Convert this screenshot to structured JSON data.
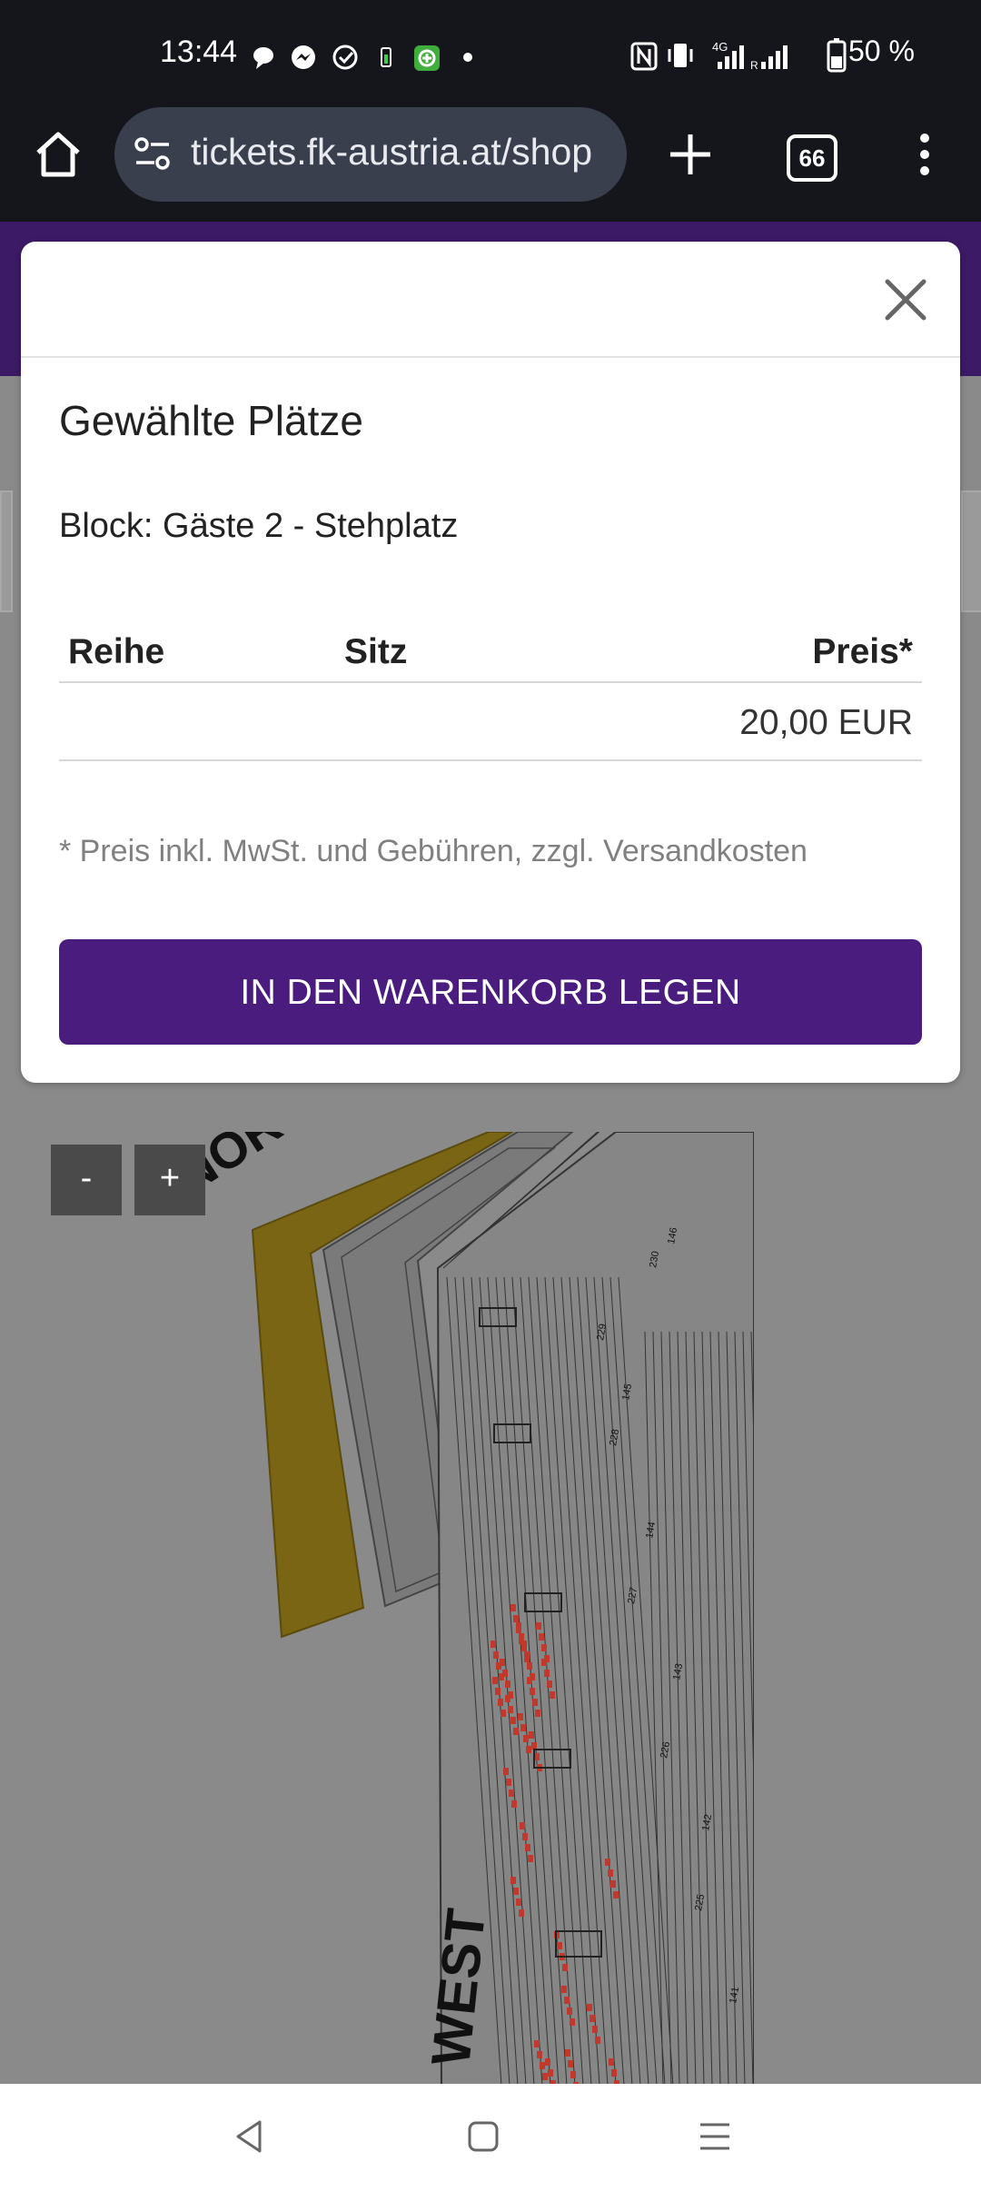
{
  "status_bar": {
    "time": "13:44",
    "network": "4G",
    "battery": "50 %",
    "notification_icons": [
      "chat-bubble-icon",
      "messenger-icon",
      "check-circle-icon",
      "battery-saver-icon",
      "green-app-icon",
      "dot-icon"
    ],
    "right_icons": [
      "nfc-icon",
      "vibrate-icon",
      "signal-4g-icon",
      "signal-roaming-icon",
      "battery-icon"
    ]
  },
  "browser": {
    "url": "tickets.fk-austria.at/shop",
    "tab_count": "66",
    "icons": [
      "home-icon",
      "site-settings-icon",
      "new-tab-icon",
      "tabs-icon",
      "more-vert-icon"
    ]
  },
  "modal": {
    "title": "Gewählte Plätze",
    "block": "Block: Gäste 2 - Stehplatz",
    "table": {
      "headers": [
        "Reihe",
        "Sitz",
        "Preis*"
      ],
      "rows": [
        {
          "reihe": "",
          "sitz": "",
          "preis": "20,00 EUR"
        }
      ]
    },
    "note": "* Preis inkl. MwSt. und Gebühren, zzgl. Versandkosten",
    "button": "IN DEN WARENKORB LEGEN",
    "close_icon": "close-icon"
  },
  "map": {
    "zoom_out": "-",
    "zoom_in": "+",
    "label_north": "NORD",
    "label_west": "WEST",
    "highlight_color": "#d6b91c",
    "taken_seat_color": "#c0392b",
    "section_numbers": [
      "230",
      "146",
      "229",
      "145",
      "228",
      "144",
      "227",
      "143",
      "226",
      "142",
      "225",
      "141"
    ]
  },
  "nav_bar": {
    "icons": [
      "back-icon",
      "home-square-icon",
      "menu-icon"
    ]
  }
}
